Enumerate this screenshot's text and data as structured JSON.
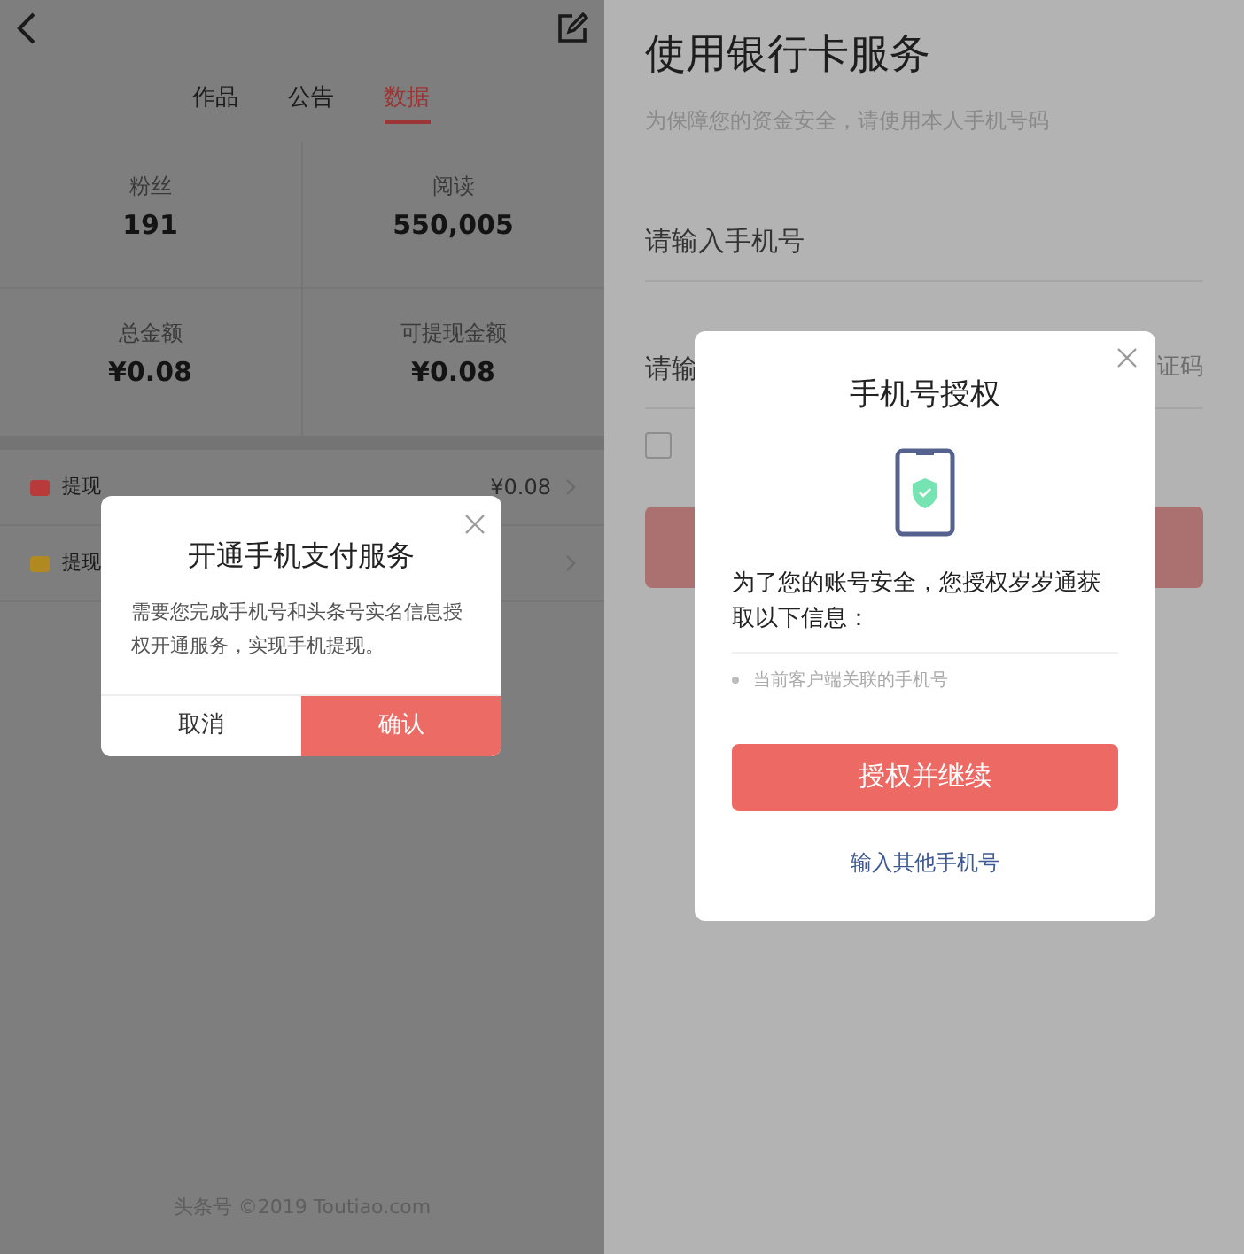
{
  "left_screen": {
    "tabs": [
      {
        "label": "作品",
        "selected": false
      },
      {
        "label": "公告",
        "selected": false
      },
      {
        "label": "数据",
        "selected": true
      }
    ],
    "stats": [
      {
        "label": "粉丝",
        "value": "191"
      },
      {
        "label": "阅读",
        "value": "550,005"
      },
      {
        "label": "总金额",
        "value": "¥0.08"
      },
      {
        "label": "可提现金额",
        "value": "¥0.08"
      }
    ],
    "list_items": [
      {
        "label": "提现",
        "value": "¥0.08",
        "color": "#b83a3a"
      },
      {
        "label": "提现",
        "color": "#b08a20"
      }
    ],
    "footer": "头条号 ©2019 Toutiao.com",
    "dialog": {
      "title": "开通手机支付服务",
      "body": "需要您完成手机号和头条号实名信息授权开通服务，实现手机提现。",
      "buttons": [
        "取消",
        "确认"
      ]
    }
  },
  "right_screen": {
    "title": "使用银行卡服务",
    "subtitle": "为保障您的资金安全，请使用本人手机号码",
    "phone_field": {
      "placeholder": "请输入手机号"
    },
    "code_field": {
      "left_text": "请输",
      "right_text": "证码"
    },
    "agree_checkbox": {
      "checked": false
    },
    "dialog": {
      "title": "手机号授权",
      "message": "为了您的账号安全，您授权岁岁通获取以下信息：",
      "items": [
        "当前客户端关联的手机号"
      ],
      "primary_button": "授权并继续",
      "link": "输入其他手机号"
    }
  }
}
